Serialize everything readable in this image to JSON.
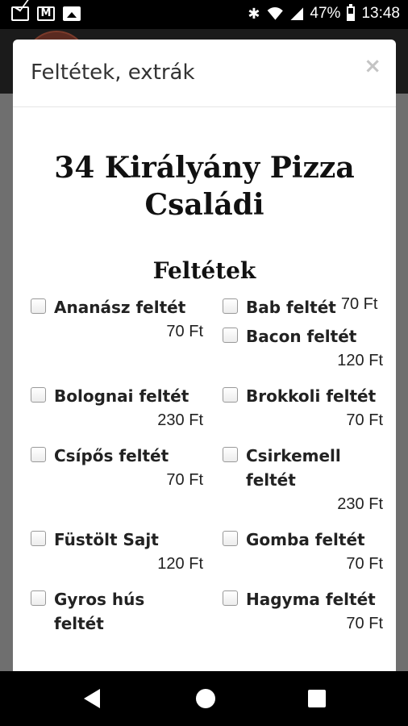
{
  "status_bar": {
    "battery": "47%",
    "time": "13:48",
    "icons": [
      "mail-icon",
      "gmail-icon",
      "image-icon",
      "bluetooth-icon",
      "wifi-icon",
      "signal-icon",
      "battery-icon"
    ]
  },
  "modal": {
    "title": "Feltétek, extrák",
    "close": "×",
    "product_title_line1": "34 Királyány Pizza",
    "product_title_line2": "Családi",
    "section_title": "Feltétek",
    "toppings": [
      {
        "name": "Ananász feltét",
        "price": "70 Ft"
      },
      {
        "name": "Bab feltét",
        "price": "70 Ft"
      },
      {
        "name": "Bacon feltét",
        "price": "120 Ft"
      },
      {
        "name": "Bolognai feltét",
        "price": "230 Ft"
      },
      {
        "name": "Brokkoli feltét",
        "price": "70 Ft"
      },
      {
        "name": "Csípős feltét",
        "price": "70 Ft"
      },
      {
        "name": "Csirkemell feltét",
        "price": "230 Ft"
      },
      {
        "name": "Füstölt Sajt",
        "price": "120 Ft"
      },
      {
        "name": "Gomba feltét",
        "price": "70 Ft"
      },
      {
        "name": "Gyros hús feltét",
        "price": ""
      },
      {
        "name": "Hagyma feltét",
        "price": "70 Ft"
      }
    ]
  },
  "nav_bar": {
    "icons": [
      "back-icon",
      "home-icon",
      "recent-apps-icon"
    ]
  }
}
